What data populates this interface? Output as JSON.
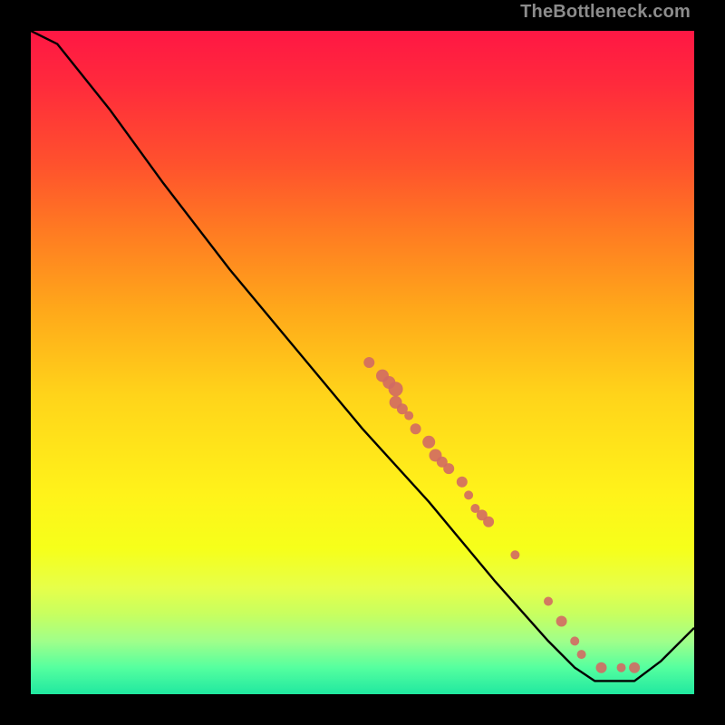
{
  "watermark": "TheBottleneck.com",
  "chart_data": {
    "type": "line",
    "title": "",
    "xlabel": "",
    "ylabel": "",
    "xlim": [
      0,
      100
    ],
    "ylim": [
      0,
      100
    ],
    "curve": [
      {
        "x": 0,
        "y": 100
      },
      {
        "x": 4,
        "y": 98
      },
      {
        "x": 8,
        "y": 93
      },
      {
        "x": 12,
        "y": 88
      },
      {
        "x": 20,
        "y": 77
      },
      {
        "x": 30,
        "y": 64
      },
      {
        "x": 40,
        "y": 52
      },
      {
        "x": 50,
        "y": 40
      },
      {
        "x": 60,
        "y": 29
      },
      {
        "x": 70,
        "y": 17
      },
      {
        "x": 78,
        "y": 8
      },
      {
        "x": 82,
        "y": 4
      },
      {
        "x": 85,
        "y": 2
      },
      {
        "x": 88,
        "y": 2
      },
      {
        "x": 91,
        "y": 2
      },
      {
        "x": 95,
        "y": 5
      },
      {
        "x": 100,
        "y": 10
      }
    ],
    "markers": [
      {
        "x": 51,
        "y": 50,
        "r": 6
      },
      {
        "x": 53,
        "y": 48,
        "r": 7
      },
      {
        "x": 54,
        "y": 47,
        "r": 7
      },
      {
        "x": 55,
        "y": 46,
        "r": 8
      },
      {
        "x": 55,
        "y": 44,
        "r": 7
      },
      {
        "x": 56,
        "y": 43,
        "r": 6
      },
      {
        "x": 57,
        "y": 42,
        "r": 5
      },
      {
        "x": 58,
        "y": 40,
        "r": 6
      },
      {
        "x": 60,
        "y": 38,
        "r": 7
      },
      {
        "x": 61,
        "y": 36,
        "r": 7
      },
      {
        "x": 62,
        "y": 35,
        "r": 6
      },
      {
        "x": 63,
        "y": 34,
        "r": 6
      },
      {
        "x": 65,
        "y": 32,
        "r": 6
      },
      {
        "x": 66,
        "y": 30,
        "r": 5
      },
      {
        "x": 67,
        "y": 28,
        "r": 5
      },
      {
        "x": 68,
        "y": 27,
        "r": 6
      },
      {
        "x": 69,
        "y": 26,
        "r": 6
      },
      {
        "x": 73,
        "y": 21,
        "r": 5
      },
      {
        "x": 78,
        "y": 14,
        "r": 5
      },
      {
        "x": 80,
        "y": 11,
        "r": 6
      },
      {
        "x": 82,
        "y": 8,
        "r": 5
      },
      {
        "x": 83,
        "y": 6,
        "r": 5
      },
      {
        "x": 86,
        "y": 4,
        "r": 6
      },
      {
        "x": 89,
        "y": 4,
        "r": 5
      },
      {
        "x": 91,
        "y": 4,
        "r": 6
      }
    ]
  }
}
